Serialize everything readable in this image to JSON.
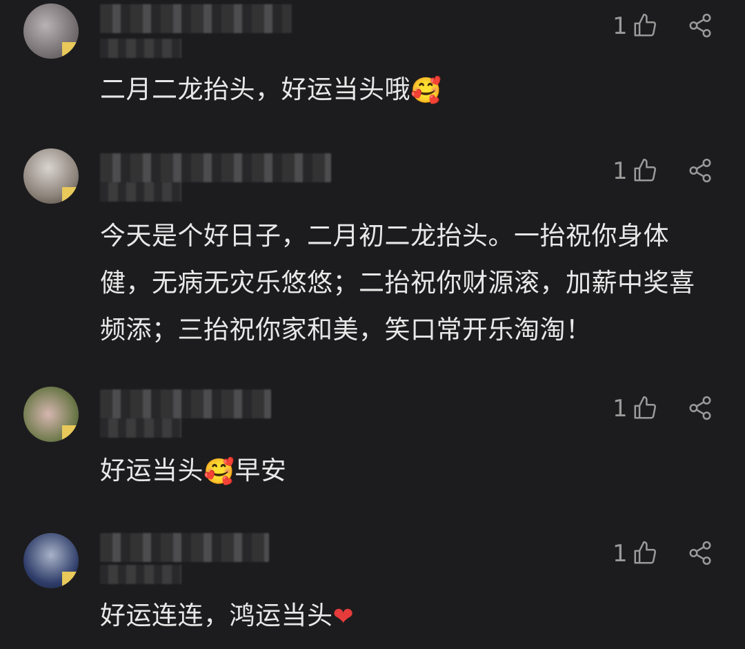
{
  "comments": [
    {
      "likes": "1",
      "text": "二月二龙抬头，好运当头哦",
      "emoji": "🥰",
      "emoji_after": ""
    },
    {
      "likes": "1",
      "text": "今天是个好日子，二月初二龙抬头。一抬祝你身体健，无病无灾乐悠悠；二抬祝你财源滚，加薪中奖喜频添；三抬祝你家和美，笑口常开乐淘淘！",
      "emoji": "",
      "emoji_after": ""
    },
    {
      "likes": "1",
      "text": "好运当头",
      "emoji": "🥰",
      "emoji_after": "早安"
    },
    {
      "likes": "1",
      "text": "好运连连，鸿运当头",
      "emoji": "❤",
      "emoji_after": ""
    }
  ],
  "icons": {
    "like": "thumbs-up-icon",
    "share": "share-icon"
  },
  "colors": {
    "background": "#1c1c1e",
    "text": "#e8e8e8",
    "muted": "#9a9a9a",
    "badge": "#e8c95a",
    "heart": "#e53b3b"
  }
}
